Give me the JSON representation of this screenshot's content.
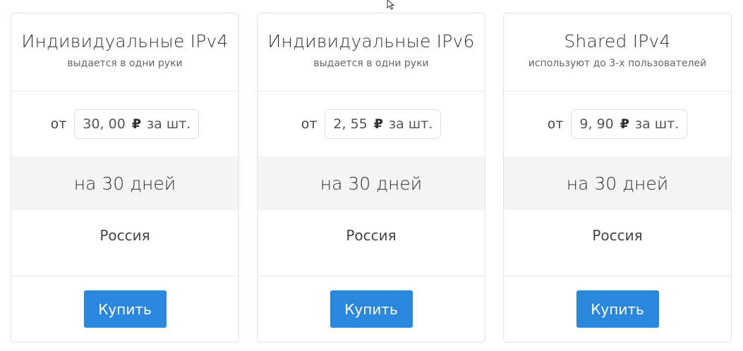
{
  "cards": [
    {
      "title": "Индивидуальные IPv4",
      "subtitle": "выдается в одни руки",
      "price_prefix": "от",
      "price_value": "30, 00",
      "currency": "₽",
      "unit": "за шт.",
      "period": "на 30 дней",
      "region": "Россия",
      "buy_label": "Купить"
    },
    {
      "title": "Индивидуальные IPv6",
      "subtitle": "выдается в одни руки",
      "price_prefix": "от",
      "price_value": "2, 55",
      "currency": "₽",
      "unit": "за шт.",
      "period": "на 30 дней",
      "region": "Россия",
      "buy_label": "Купить"
    },
    {
      "title": "Shared IPv4",
      "subtitle": "используют до 3-х пользователей",
      "price_prefix": "от",
      "price_value": "9, 90",
      "currency": "₽",
      "unit": "за шт.",
      "period": "на 30 дней",
      "region": "Россия",
      "buy_label": "Купить"
    }
  ],
  "colors": {
    "button_bg": "#2b87db",
    "period_bg": "#f4f4f4",
    "border": "#e3e3e3"
  },
  "icons": {
    "cursor": "mouse-pointer-icon"
  }
}
